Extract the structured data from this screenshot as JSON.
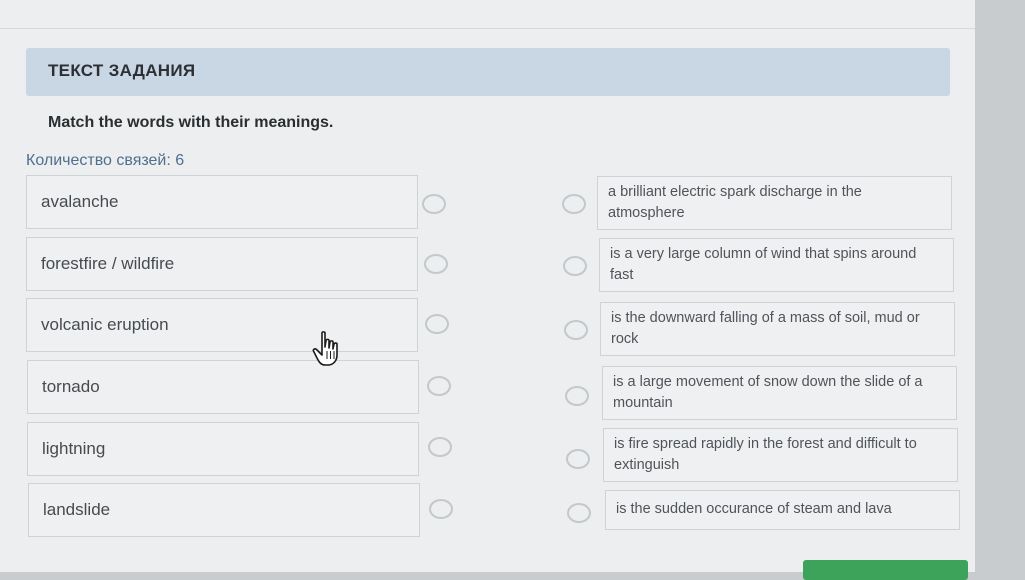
{
  "header": {
    "title": "ТЕКСТ ЗАДАНИЯ"
  },
  "task": {
    "instruction": "Match the words with their meanings.",
    "connections_count": "Количество связей: 6"
  },
  "left_items": [
    "avalanche",
    "forestfire / wildfire",
    "volcanic eruption",
    "tornado",
    "lightning",
    "landslide"
  ],
  "right_items": [
    "a brilliant electric spark discharge in the atmosphere",
    "is a very large column of wind that spins around fast",
    "is the downward falling of a mass of soil, mud or rock",
    "is a large movement of snow down the slide of a mountain",
    "is fire spread rapidly in the forest and difficult to extinguish",
    "is the sudden occurance of steam and lava"
  ],
  "icons": {
    "cursor": "hand-pointer-icon"
  },
  "colors": {
    "header_band": "#c9d6e3",
    "count_text": "#4f6f8f",
    "button": "#3da35a"
  }
}
